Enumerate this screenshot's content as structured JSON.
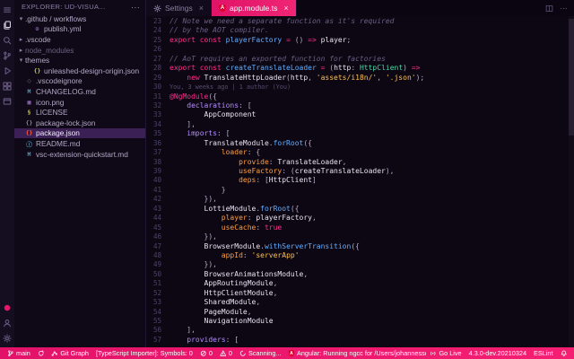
{
  "colors": {
    "accent_pink": "#e6156d",
    "angular_red": "#dd0031",
    "editor_bg": "#0d0714",
    "statusbar_bg": "#e6156d"
  },
  "activity_bar": {
    "top": [
      {
        "icon": "menu",
        "active": false
      },
      {
        "icon": "files",
        "active": true
      },
      {
        "icon": "search",
        "active": false
      },
      {
        "icon": "source-control",
        "active": false
      },
      {
        "icon": "debug",
        "active": false
      },
      {
        "icon": "extensions",
        "active": false
      },
      {
        "icon": "window",
        "active": false
      }
    ],
    "bottom": [
      {
        "icon": "circle",
        "color": "#e6156d"
      },
      {
        "icon": "account"
      },
      {
        "icon": "gear"
      }
    ]
  },
  "sidebar": {
    "header": {
      "title": "EXPLORER: UD-VISUA...",
      "actions": "···"
    },
    "tree": [
      {
        "label": ".github / workflows",
        "kind": "folder",
        "expanded": true,
        "indent": 0
      },
      {
        "label": "publish.yml",
        "kind": "file",
        "icon": "yaml-icon",
        "glyph": "⚙",
        "color": "#a074c4",
        "indent": 1
      },
      {
        "label": ".vscode",
        "kind": "folder",
        "expanded": false,
        "indent": 0
      },
      {
        "label": "node_modules",
        "kind": "folder",
        "expanded": false,
        "indent": 0,
        "dim": true
      },
      {
        "label": "themes",
        "kind": "folder",
        "expanded": true,
        "indent": 0
      },
      {
        "label": "unleashed-design-origin.json",
        "kind": "file",
        "icon": "json-icon",
        "glyph": "{}",
        "color": "#cbcb41",
        "indent": 1
      },
      {
        "label": ".vscodeignore",
        "kind": "file",
        "icon": "ignore-icon",
        "glyph": "◌",
        "color": "#8a8494",
        "indent": 0
      },
      {
        "label": "CHANGELOG.md",
        "kind": "file",
        "icon": "markdown-icon",
        "glyph": "M",
        "color": "#519aba",
        "indent": 0
      },
      {
        "label": "icon.png",
        "kind": "file",
        "icon": "image-icon",
        "glyph": "▦",
        "color": "#a074c4",
        "indent": 0
      },
      {
        "label": "LICENSE",
        "kind": "file",
        "icon": "license-icon",
        "glyph": "§",
        "color": "#cbcb41",
        "indent": 0
      },
      {
        "label": "package-lock.json",
        "kind": "file",
        "icon": "json-icon",
        "glyph": "{}",
        "color": "#8a8494",
        "indent": 0
      },
      {
        "label": "package.json",
        "kind": "file",
        "icon": "npm-icon",
        "glyph": "{}",
        "color": "#ff5a3c",
        "indent": 0,
        "selected": true
      },
      {
        "label": "README.md",
        "kind": "file",
        "icon": "info-icon",
        "glyph": "ⓘ",
        "color": "#519aba",
        "indent": 0
      },
      {
        "label": "vsc-extension-quickstart.md",
        "kind": "file",
        "icon": "markdown-icon",
        "glyph": "M",
        "color": "#519aba",
        "indent": 0
      }
    ]
  },
  "tabs": [
    {
      "label": "Settings",
      "icon": "gear",
      "active": false
    },
    {
      "label": "app.module.ts",
      "icon": "angular",
      "active": true
    }
  ],
  "editor": {
    "lines": [
      {
        "n": "23",
        "tk": [
          [
            "cm",
            "// Note we need a separate function as it's required"
          ]
        ]
      },
      {
        "n": "24",
        "tk": [
          [
            "cm",
            "// by the AOT compiler."
          ]
        ]
      },
      {
        "n": "25",
        "tk": [
          [
            "kw",
            "export const "
          ],
          [
            "fn",
            "playerFactory"
          ],
          [
            "pun",
            " "
          ],
          [
            "kw",
            "="
          ],
          [
            "pun",
            " () "
          ],
          [
            "kw",
            "=>"
          ],
          [
            "id",
            " player"
          ],
          [
            "pun",
            ";"
          ]
        ]
      },
      {
        "n": "26",
        "tk": []
      },
      {
        "n": "27",
        "tk": [
          [
            "cm",
            "// AoT requires an exported function for factories"
          ]
        ]
      },
      {
        "n": "28",
        "tk": [
          [
            "kw",
            "export const "
          ],
          [
            "fn",
            "createTranslateLoader"
          ],
          [
            "pun",
            " "
          ],
          [
            "kw",
            "="
          ],
          [
            "pun",
            " ("
          ],
          [
            "id",
            "http"
          ],
          [
            "pun",
            ": "
          ],
          [
            "typ",
            "HttpClient"
          ],
          [
            "pun",
            ") "
          ],
          [
            "kw",
            "=>"
          ]
        ]
      },
      {
        "n": "29",
        "tk": [
          [
            "pun",
            "    "
          ],
          [
            "kw",
            "new "
          ],
          [
            "id",
            "TranslateHttpLoader"
          ],
          [
            "pun",
            "("
          ],
          [
            "id",
            "http"
          ],
          [
            "pun",
            ", "
          ],
          [
            "str",
            "'assets/i18n/'"
          ],
          [
            "pun",
            ", "
          ],
          [
            "str",
            "'.json'"
          ],
          [
            "pun",
            ");"
          ]
        ]
      },
      {
        "n": "30",
        "tk": [
          [
            "lens",
            "You, 3 weeks ago | 1 author (You)"
          ]
        ]
      },
      {
        "n": "31",
        "tk": [
          [
            "kw",
            "@NgModule"
          ],
          [
            "pun",
            "({"
          ]
        ]
      },
      {
        "n": "32",
        "tk": [
          [
            "pun",
            "    "
          ],
          [
            "key",
            "declarations"
          ],
          [
            "pun",
            ": ["
          ]
        ]
      },
      {
        "n": "33",
        "tk": [
          [
            "id",
            "        AppComponent"
          ]
        ]
      },
      {
        "n": "34",
        "tk": [
          [
            "pun",
            "    ],"
          ]
        ]
      },
      {
        "n": "35",
        "tk": [
          [
            "pun",
            "    "
          ],
          [
            "key",
            "imports"
          ],
          [
            "pun",
            ": ["
          ]
        ]
      },
      {
        "n": "36",
        "tk": [
          [
            "pun",
            "        "
          ],
          [
            "id",
            "TranslateModule"
          ],
          [
            "pun",
            "."
          ],
          [
            "fn",
            "forRoot"
          ],
          [
            "pun",
            "({"
          ]
        ]
      },
      {
        "n": "37",
        "tk": [
          [
            "pun",
            "            "
          ],
          [
            "prop",
            "loader"
          ],
          [
            "pun",
            ": {"
          ]
        ]
      },
      {
        "n": "38",
        "tk": [
          [
            "pun",
            "                "
          ],
          [
            "prop",
            "provide"
          ],
          [
            "pun",
            ": "
          ],
          [
            "id",
            "TranslateLoader"
          ],
          [
            "pun",
            ","
          ]
        ]
      },
      {
        "n": "39",
        "tk": [
          [
            "pun",
            "                "
          ],
          [
            "prop",
            "useFactory"
          ],
          [
            "pun",
            ": ("
          ],
          [
            "id",
            "createTranslateLoader"
          ],
          [
            "pun",
            "),"
          ]
        ]
      },
      {
        "n": "40",
        "tk": [
          [
            "pun",
            "                "
          ],
          [
            "prop",
            "deps"
          ],
          [
            "pun",
            ": ["
          ],
          [
            "id",
            "HttpClient"
          ],
          [
            "pun",
            "]"
          ]
        ]
      },
      {
        "n": "41",
        "tk": [
          [
            "pun",
            "            }"
          ]
        ]
      },
      {
        "n": "42",
        "tk": [
          [
            "pun",
            "        }),"
          ]
        ]
      },
      {
        "n": "43",
        "tk": [
          [
            "pun",
            "        "
          ],
          [
            "id",
            "LottieModule"
          ],
          [
            "pun",
            "."
          ],
          [
            "fn",
            "forRoot"
          ],
          [
            "pun",
            "({"
          ]
        ]
      },
      {
        "n": "44",
        "tk": [
          [
            "pun",
            "            "
          ],
          [
            "prop",
            "player"
          ],
          [
            "pun",
            ": "
          ],
          [
            "id",
            "playerFactory"
          ],
          [
            "pun",
            ","
          ]
        ]
      },
      {
        "n": "45",
        "tk": [
          [
            "pun",
            "            "
          ],
          [
            "prop",
            "useCache"
          ],
          [
            "pun",
            ": "
          ],
          [
            "kw",
            "true"
          ]
        ]
      },
      {
        "n": "46",
        "tk": [
          [
            "pun",
            "        }),"
          ]
        ]
      },
      {
        "n": "47",
        "tk": [
          [
            "pun",
            "        "
          ],
          [
            "id",
            "BrowserModule"
          ],
          [
            "pun",
            "."
          ],
          [
            "fn",
            "withServerTransition"
          ],
          [
            "pun",
            "({"
          ]
        ]
      },
      {
        "n": "48",
        "tk": [
          [
            "pun",
            "            "
          ],
          [
            "prop",
            "appId"
          ],
          [
            "pun",
            ": "
          ],
          [
            "str",
            "'serverApp'"
          ]
        ]
      },
      {
        "n": "49",
        "tk": [
          [
            "pun",
            "        }),"
          ]
        ]
      },
      {
        "n": "50",
        "tk": [
          [
            "id",
            "        BrowserAnimationsModule"
          ],
          [
            "pun",
            ","
          ]
        ]
      },
      {
        "n": "51",
        "tk": [
          [
            "id",
            "        AppRoutingModule"
          ],
          [
            "pun",
            ","
          ]
        ]
      },
      {
        "n": "52",
        "tk": [
          [
            "id",
            "        HttpClientModule"
          ],
          [
            "pun",
            ","
          ]
        ]
      },
      {
        "n": "53",
        "tk": [
          [
            "id",
            "        SharedModule"
          ],
          [
            "pun",
            ","
          ]
        ]
      },
      {
        "n": "54",
        "tk": [
          [
            "id",
            "        PageModule"
          ],
          [
            "pun",
            ","
          ]
        ]
      },
      {
        "n": "55",
        "tk": [
          [
            "id",
            "        NavigationModule"
          ]
        ]
      },
      {
        "n": "56",
        "tk": [
          [
            "pun",
            "    ],"
          ]
        ]
      },
      {
        "n": "57",
        "tk": [
          [
            "pun",
            "    "
          ],
          [
            "key",
            "providers"
          ],
          [
            "pun",
            ": ["
          ]
        ]
      }
    ]
  },
  "status_bar": {
    "left": [
      {
        "name": "branch",
        "icon": "branch",
        "text": "main"
      },
      {
        "name": "sync",
        "icon": "sync",
        "text": ""
      },
      {
        "name": "git-graph",
        "icon": "graph",
        "text": "Git Graph"
      },
      {
        "name": "ts-importer",
        "text": "[TypeScript Importer]: Symbols: 0"
      },
      {
        "name": "problems-errors",
        "icon": "error",
        "text": "0"
      },
      {
        "name": "problems-warnings",
        "icon": "warning",
        "text": "0"
      },
      {
        "name": "scanning",
        "icon": "spinner",
        "text": "Scanning..."
      },
      {
        "name": "angular-ngcc",
        "icon": "angular",
        "text": "Angular: Running ngcc for /Users/johannesschiel/Documents/Development/ud-frontend/tsconfig.j"
      }
    ],
    "right": [
      {
        "name": "go-live",
        "icon": "broadcast",
        "text": "Go Live"
      },
      {
        "name": "typescript-version",
        "text": "4.3.0-dev.20210324"
      },
      {
        "name": "eslint",
        "text": "ESLint"
      },
      {
        "name": "notifications",
        "icon": "bell",
        "text": ""
      }
    ]
  }
}
